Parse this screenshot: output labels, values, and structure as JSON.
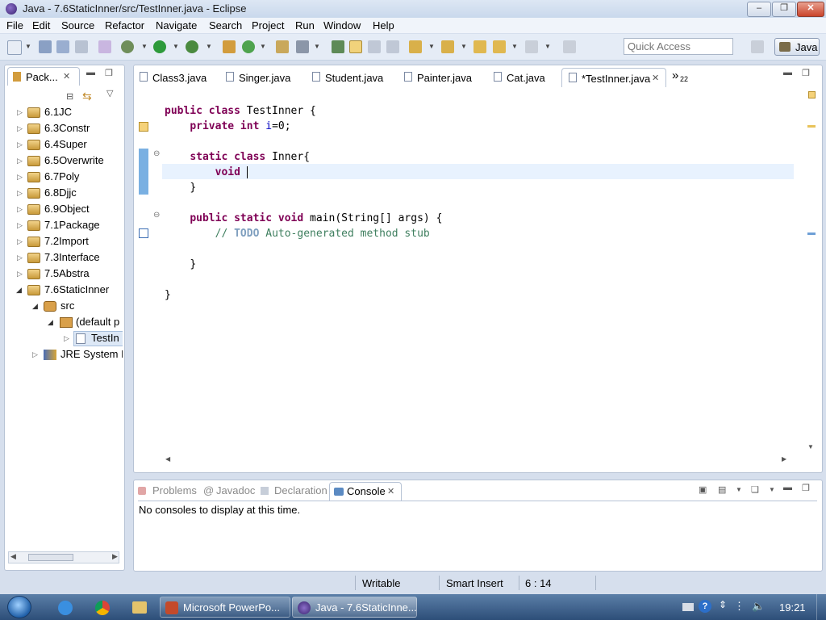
{
  "window": {
    "title": "Java - 7.6StaticInner/src/TestInner.java - Eclipse"
  },
  "menubar": {
    "items": [
      "File",
      "Edit",
      "Source",
      "Refactor",
      "Navigate",
      "Search",
      "Project",
      "Run",
      "Window",
      "Help"
    ]
  },
  "toolbar": {
    "quick_access_placeholder": "Quick Access",
    "perspective_label": "Java"
  },
  "package_explorer": {
    "tab_label": "Pack...",
    "items": [
      {
        "label": "6.1JC",
        "type": "project",
        "expanded": false
      },
      {
        "label": "6.3Constr",
        "type": "project",
        "expanded": false
      },
      {
        "label": "6.4Super",
        "type": "project",
        "expanded": false
      },
      {
        "label": "6.5Overwrite",
        "type": "project",
        "expanded": false
      },
      {
        "label": "6.7Poly",
        "type": "project",
        "expanded": false
      },
      {
        "label": "6.8Djjc",
        "type": "project",
        "expanded": false
      },
      {
        "label": "6.9Object",
        "type": "project",
        "expanded": false
      },
      {
        "label": "7.1Package",
        "type": "project",
        "expanded": false
      },
      {
        "label": "7.2Import",
        "type": "project",
        "expanded": false
      },
      {
        "label": "7.3Interface",
        "type": "project",
        "expanded": false
      },
      {
        "label": "7.5Abstra",
        "type": "project",
        "expanded": false
      },
      {
        "label": "7.6StaticInner",
        "type": "project",
        "expanded": true
      },
      {
        "label": "src",
        "type": "src",
        "expanded": true
      },
      {
        "label": "(default p",
        "type": "package",
        "expanded": true
      },
      {
        "label": "TestIn",
        "type": "file",
        "expanded": false
      },
      {
        "label": "JRE System L",
        "type": "jre",
        "expanded": false
      }
    ]
  },
  "editor": {
    "tabs": [
      {
        "label": "Class3.java",
        "active": false
      },
      {
        "label": "Singer.java",
        "active": false
      },
      {
        "label": "Student.java",
        "active": false
      },
      {
        "label": "Painter.java",
        "active": false
      },
      {
        "label": "Cat.java",
        "active": false
      },
      {
        "label": "*TestInner.java",
        "active": true
      }
    ],
    "overflow_label": "»",
    "overflow_count": "22",
    "code": {
      "l1_kw": "public class ",
      "l1_rest": "TestInner {",
      "l2_kw": "private int ",
      "l2_field": "i",
      "l2_rest": "=0;",
      "l3_kw": "static class ",
      "l3_rest": "Inner{",
      "l4_kw": "void ",
      "l5": "}",
      "l6_kw": "public static void ",
      "l6_rest": "main(String[] args) {",
      "l7_a": "// ",
      "l7_todo": "TODO",
      "l7_b": " Auto-generated method stub",
      "l8": "}",
      "l9": "}"
    }
  },
  "console": {
    "tabs": [
      {
        "label": "Problems",
        "active": false
      },
      {
        "label": "Javadoc",
        "active": false
      },
      {
        "label": "Declaration",
        "active": false
      },
      {
        "label": "Console",
        "active": true
      }
    ],
    "message": "No consoles to display at this time."
  },
  "statusbar": {
    "writable": "Writable",
    "insert_mode": "Smart Insert",
    "position": "6 : 14"
  },
  "taskbar": {
    "buttons": [
      {
        "label": "Microsoft PowerPo..."
      },
      {
        "label": "Java - 7.6StaticInne..."
      }
    ],
    "clock": "19:21"
  }
}
